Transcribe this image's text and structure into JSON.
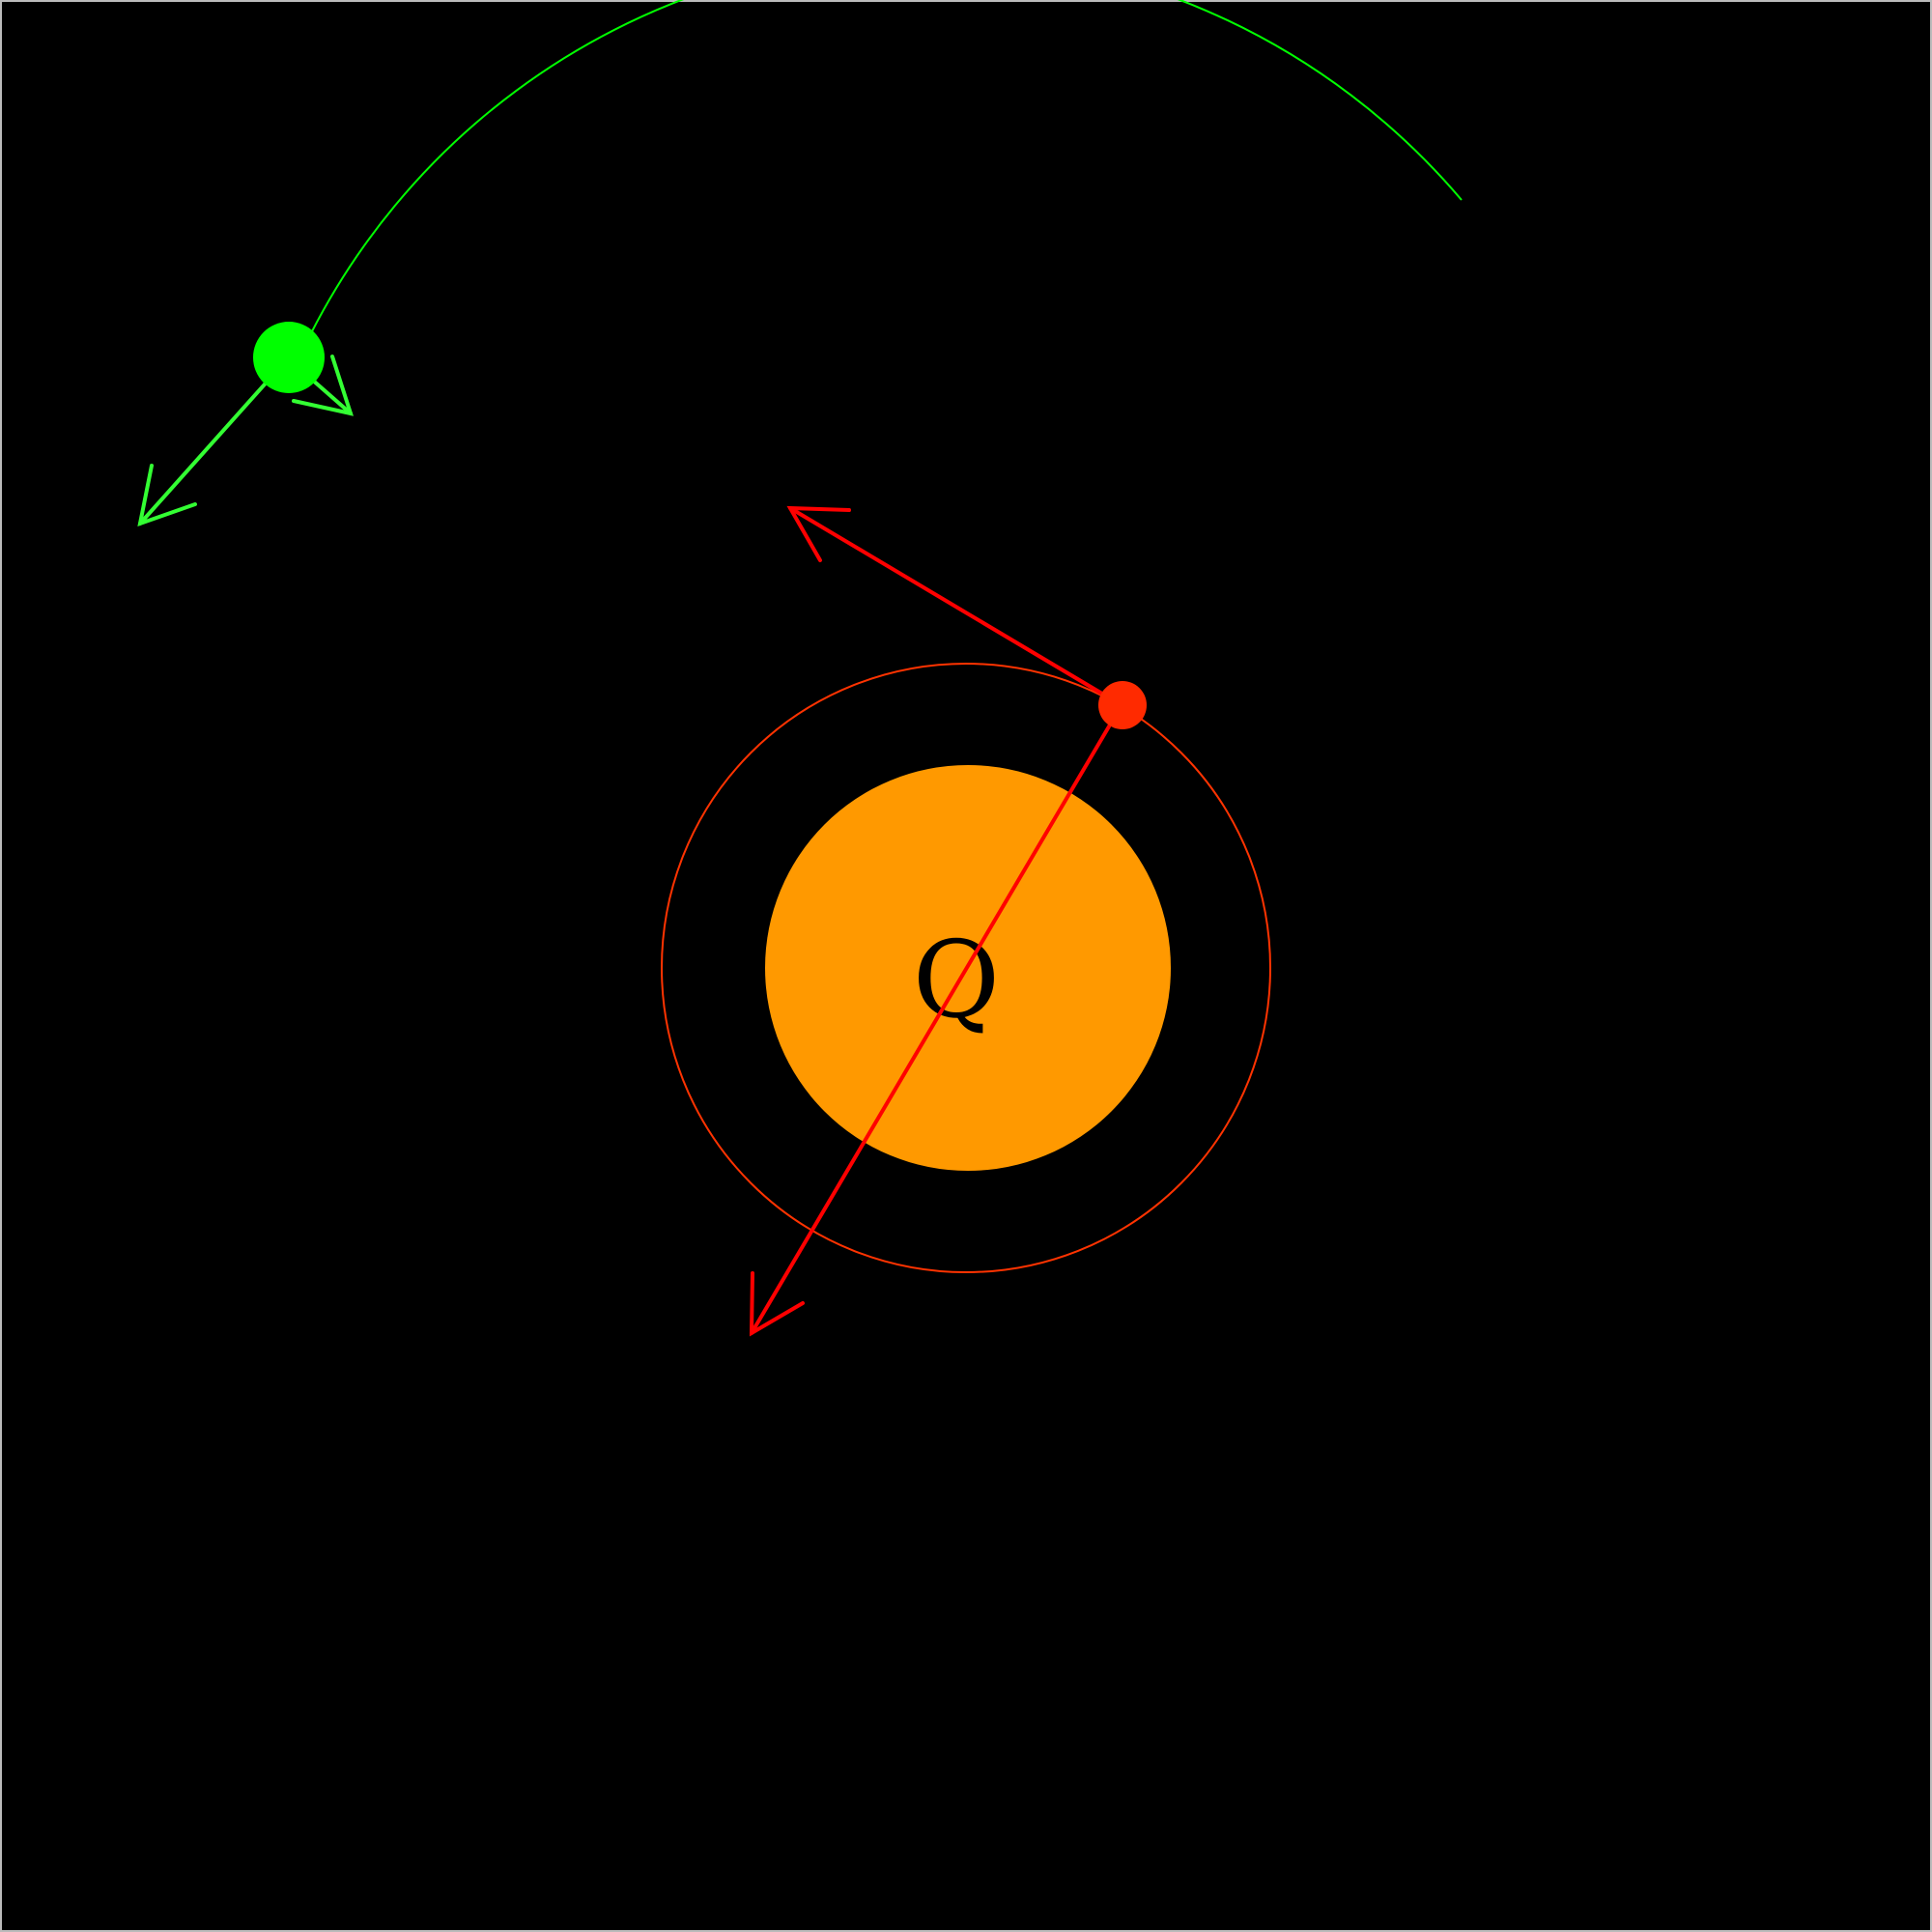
{
  "diagram": {
    "background_color": "#000000",
    "border_color": "#bbbbbb",
    "star": {
      "label": "Q",
      "color": "#ff9900",
      "label_color": "#000000"
    },
    "inner_orbit": {
      "color": "#ff3300"
    },
    "inner_body": {
      "color": "#ff2a00",
      "vector_color": "#ff0000"
    },
    "outer_orbit": {
      "color": "#00ff00"
    },
    "outer_body": {
      "color": "#00ff00",
      "vector_color": "#33ff33"
    }
  }
}
